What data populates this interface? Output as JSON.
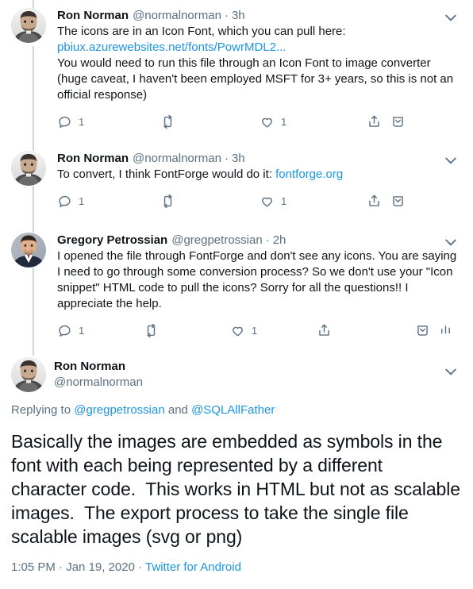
{
  "thread": {
    "tweets": [
      {
        "name": "Ron Norman",
        "handle": "@normalnorman",
        "time": "3h",
        "text_before_link": "The icons are in an Icon Font, which you can pull here:\n",
        "link": "pbiux.azurewebsites.net/fonts/PowrMDL2...",
        "text_after_link": "\nYou would need to run this file through an Icon Font to image converter (huge caveat, I haven't been employed MSFT for 3+ years, so this is not an official response)",
        "actions": {
          "reply_count": "1",
          "retweet_count": "",
          "like_count": "1"
        }
      },
      {
        "name": "Ron Norman",
        "handle": "@normalnorman",
        "time": "3h",
        "text_before_link": "To convert, I think FontForge would do it: ",
        "link": "fontforge.org",
        "text_after_link": "",
        "actions": {
          "reply_count": "1",
          "retweet_count": "",
          "like_count": "1"
        }
      },
      {
        "name": "Gregory Petrossian",
        "handle": "@gregpetrossian",
        "time": "2h",
        "text_before_link": "I opened the file through FontForge and don't see any icons. You are saying I need to go through some conversion process? So we don't use your \"Icon snippet\" HTML code to pull the icons? Sorry for all the questions!! I appreciate the help.",
        "link": "",
        "text_after_link": "",
        "actions": {
          "reply_count": "1",
          "retweet_count": "",
          "like_count": "1"
        }
      }
    ]
  },
  "main_tweet": {
    "name": "Ron Norman",
    "handle": "@normalnorman",
    "replying_to_label": "Replying to ",
    "replying_to_handle_1": "@gregpetrossian",
    "replying_to_conjunction": " and ",
    "replying_to_handle_2": "@SQLAllFather",
    "body": "Basically the images are embedded as symbols in the font with each being represented by a different character code.  This works in HTML but not as scalable images.  The export process to take the single file scalable images (svg or png)",
    "time": "1:05 PM",
    "meta_sep_1": " · ",
    "date": "Jan 19, 2020",
    "meta_sep_2": " · ",
    "source": "Twitter for Android"
  },
  "icons": {
    "chevron_down": "chevron-down-icon",
    "reply": "reply-icon",
    "retweet": "retweet-icon",
    "like": "heart-icon",
    "share": "share-icon",
    "bookmark": "bookmark-icon",
    "analytics": "analytics-bar-icon"
  },
  "colors": {
    "link": "#1b95e0",
    "muted": "#5b7083",
    "text": "#0f1419",
    "thread_line": "#ccd6dd",
    "divider": "#ebeef0"
  }
}
